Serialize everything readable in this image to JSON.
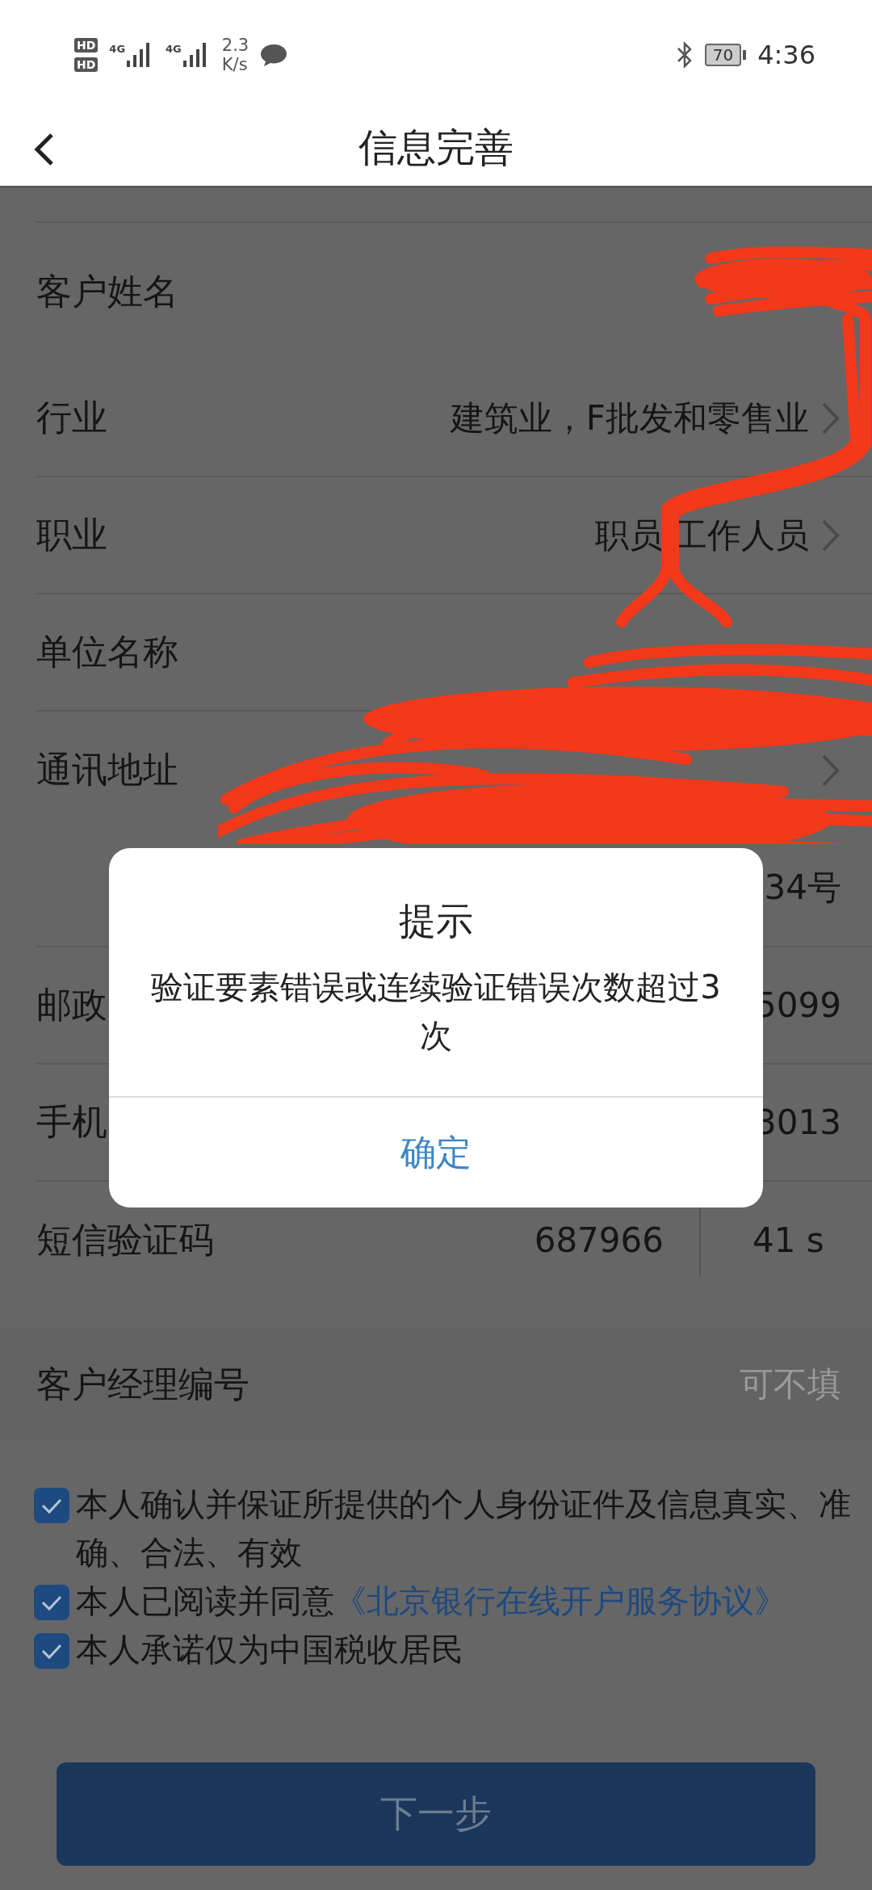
{
  "status_bar": {
    "sim_badges": [
      "HD",
      "HD"
    ],
    "networks": [
      "4G",
      "4G"
    ],
    "speed_value": "2.3",
    "speed_unit": "K/s",
    "battery": "70",
    "time": "4:36"
  },
  "header": {
    "title": "信息完善"
  },
  "rows": [
    {
      "kind": "field",
      "label": "客户姓名",
      "chevron": false
    },
    {
      "kind": "field",
      "label": "行业",
      "value": "建筑业，F批发和零售业",
      "chevron": true
    },
    {
      "kind": "field",
      "label": "职业",
      "value": "职员 工作人员",
      "chevron": true
    },
    {
      "kind": "field",
      "label": "单位名称",
      "chevron": false
    },
    {
      "kind": "address",
      "label": "通讯地址",
      "chevron": true,
      "continued": "34号"
    },
    {
      "kind": "field",
      "label": "邮政",
      "value": "5099",
      "chevron": false
    },
    {
      "kind": "field",
      "label": "手机",
      "value": "3013",
      "chevron": false
    },
    {
      "kind": "code",
      "label": "短信验证码",
      "value": "687966",
      "timer": "41 s",
      "chevron": false
    }
  ],
  "manager": {
    "label": "客户经理编号",
    "placeholder": "可不填"
  },
  "agreements": [
    {
      "checked": true,
      "text": "本人确认并保证所提供的个人身份证件及信息真实、准确、合法、有效"
    },
    {
      "checked": true,
      "text": "本人已阅读并同意",
      "link": "《北京银行在线开户服务协议》"
    },
    {
      "checked": true,
      "text": "本人承诺仅为中国税收居民"
    }
  ],
  "next_button": {
    "label": "下一步",
    "disabled": true
  },
  "dialog": {
    "title": "提示",
    "message": "验证要素错误或连续验证错误次数超过3次",
    "button": "确定"
  }
}
